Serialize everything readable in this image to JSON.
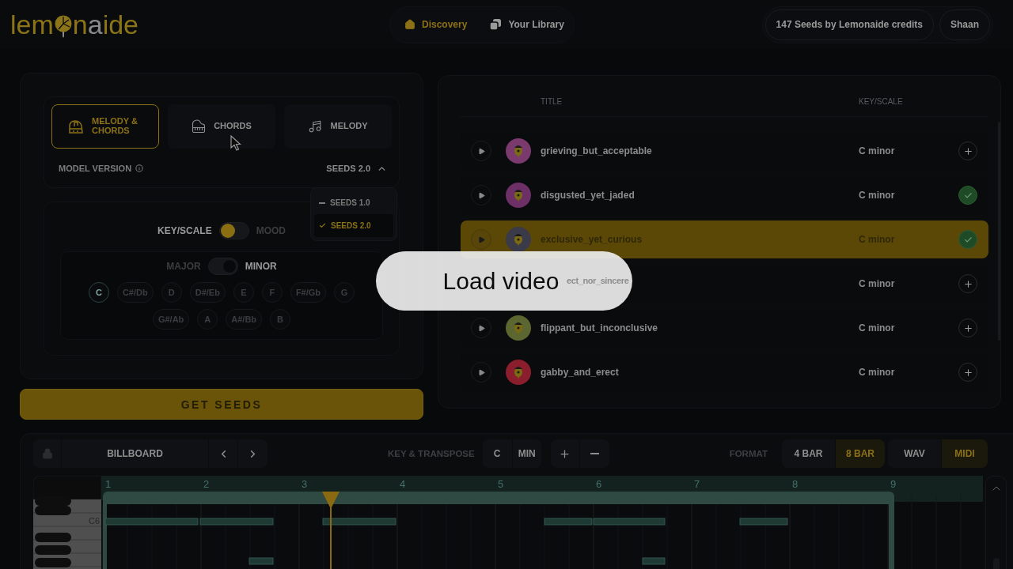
{
  "header": {
    "logo": [
      {
        "text": "lem",
        "kind": "accent"
      },
      {
        "text": "n",
        "kind": "accent"
      },
      {
        "text": "a",
        "kind": "plain"
      },
      {
        "text": "ide",
        "kind": "accent"
      }
    ],
    "nav": [
      {
        "label": "Discovery",
        "selected": true
      },
      {
        "label": "Your Library",
        "selected": false
      }
    ],
    "credits": "147 Seeds by Lemonaide credits",
    "user": "Shaan"
  },
  "generator": {
    "modes": [
      {
        "label": "MELODY & CHORDS",
        "selected": true
      },
      {
        "label": "CHORDS",
        "selected": false
      },
      {
        "label": "MELODY",
        "selected": false
      }
    ],
    "model_version": {
      "label": "MODEL VERSION",
      "value": "SEEDS 2.0",
      "expanded": true,
      "options": [
        {
          "label": "SEEDS 1.0",
          "selected": false
        },
        {
          "label": "SEEDS 2.0",
          "selected": true
        }
      ]
    },
    "toggles": [
      {
        "kind": "accent",
        "options": [
          {
            "label": "KEY/SCALE",
            "selected": true
          },
          {
            "label": "MOOD",
            "selected": false
          }
        ]
      },
      {
        "kind": "plain",
        "options": [
          {
            "label": "MAJOR",
            "selected": false
          },
          {
            "label": "MINOR",
            "selected": true
          }
        ]
      }
    ],
    "keys": [
      {
        "label": "C",
        "selected": true
      },
      {
        "label": "C#/Db",
        "selected": false
      },
      {
        "label": "D",
        "selected": false
      },
      {
        "label": "D#/Eb",
        "selected": false
      },
      {
        "label": "E",
        "selected": false
      },
      {
        "label": "F",
        "selected": false
      },
      {
        "label": "F#/Gb",
        "selected": false
      },
      {
        "label": "G",
        "selected": false
      },
      {
        "label": "G#/Ab",
        "selected": false
      },
      {
        "label": "A",
        "selected": false
      },
      {
        "label": "A#/Bb",
        "selected": false
      },
      {
        "label": "B",
        "selected": false
      }
    ],
    "submit": "GET SEEDS"
  },
  "results": {
    "columns": [
      "TITLE",
      "KEY/SCALE"
    ],
    "rows": [
      {
        "title": "grieving_but_acceptable",
        "key": "C minor",
        "color": "#7a3a6e",
        "added": false,
        "selected": false,
        "covered": false
      },
      {
        "title": "disgusted_yet_jaded",
        "key": "C minor",
        "color": "#6c2f66",
        "added": true,
        "selected": false,
        "covered": false
      },
      {
        "title": "exclusive_yet_curious",
        "key": "C minor",
        "color": "#3a3a48",
        "added": true,
        "selected": true,
        "covered": false
      },
      {
        "title": "ect_nor_sincere",
        "key": "C minor",
        "added": false,
        "selected": false,
        "covered": true
      },
      {
        "title": "flippant_but_inconclusive",
        "key": "C minor",
        "color": "#5c6630",
        "added": false,
        "selected": false,
        "covered": false
      },
      {
        "title": "gabby_and_erect",
        "key": "C minor",
        "color": "#8a1e2c",
        "added": false,
        "selected": false,
        "covered": false
      }
    ]
  },
  "editor": {
    "preset": "BILLBOARD",
    "key_label": "KEY & TRANSPOSE",
    "key": "C",
    "scale": "MIN",
    "format_label": "FORMAT",
    "lengths": [
      {
        "label": "4 BAR",
        "selected": false
      },
      {
        "label": "8 BAR",
        "selected": true
      }
    ],
    "formats": [
      {
        "label": "WAV",
        "selected": false
      },
      {
        "label": "MIDI",
        "selected": true
      }
    ],
    "octave_label": "C6",
    "bars": [
      "1",
      "2",
      "3",
      "4",
      "5",
      "6",
      "7",
      "8",
      "9"
    ]
  },
  "overlay": {
    "button": "Load video"
  }
}
